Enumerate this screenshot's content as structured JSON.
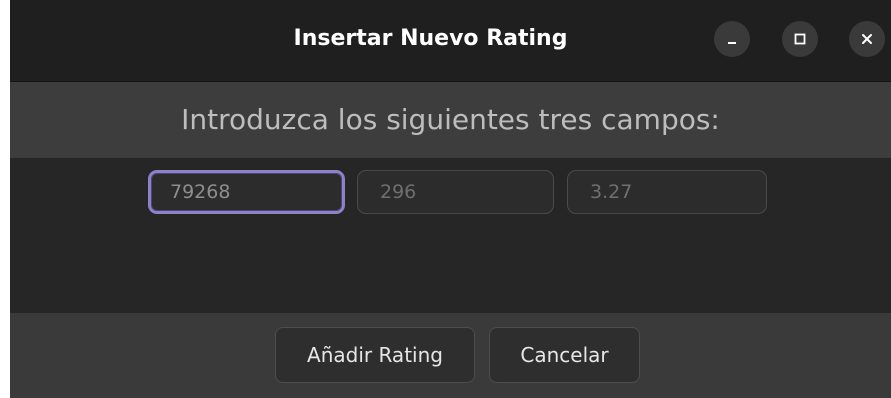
{
  "window": {
    "title": "Insertar Nuevo Rating",
    "controls": {
      "minimize_icon": "minimize-icon",
      "maximize_icon": "maximize-icon",
      "close_icon": "close-icon"
    }
  },
  "prompt": {
    "text": "Introduzca los siguientes tres campos:"
  },
  "fields": [
    {
      "value": "79268",
      "focused": true
    },
    {
      "value": "296"
    },
    {
      "value": "3.27"
    }
  ],
  "buttons": {
    "add_label": "Añadir Rating",
    "cancel_label": "Cancelar"
  },
  "colors": {
    "focus_ring": "#8c82c9",
    "window_bg": "#2b2b2b",
    "titlebar_bg": "#1f1f1f"
  }
}
